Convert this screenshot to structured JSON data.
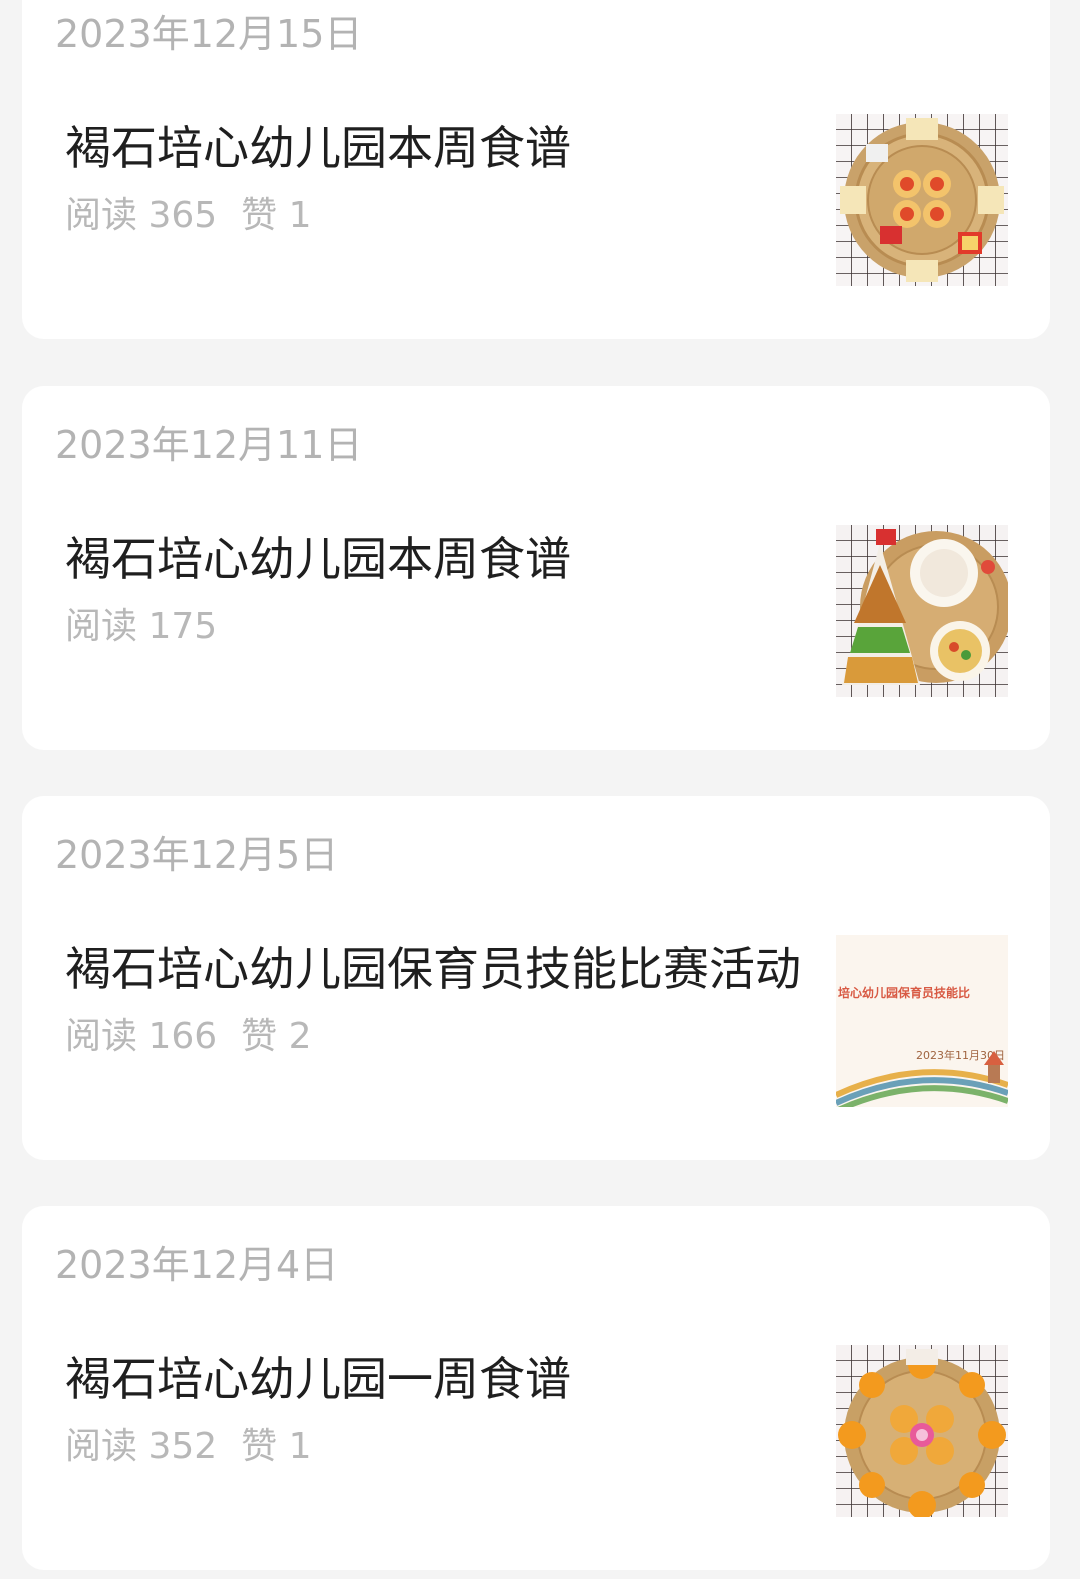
{
  "articles": [
    {
      "date": "2023年12月15日",
      "title": "褐石培心幼儿园本周食谱",
      "reads": "阅读 365",
      "likes": "赞 1",
      "thumb_icon": "food-plate-icon"
    },
    {
      "date": "2023年12月11日",
      "title": "褐石培心幼儿园本周食谱",
      "reads": "阅读 175",
      "likes": "",
      "thumb_icon": "meal-tray-icon"
    },
    {
      "date": "2023年12月5日",
      "title": "褐石培心幼儿园保育员技能比赛活动",
      "reads": "阅读 166",
      "likes": "赞 2",
      "thumb_icon": "event-banner-icon",
      "thumb_text_top": "培心幼儿园保育员技能比",
      "thumb_text_date": "2023年11月30日"
    },
    {
      "date": "2023年12月4日",
      "title": "褐石培心幼儿园一周食谱",
      "reads": "阅读 352",
      "likes": "赞 1",
      "thumb_icon": "orange-plate-icon"
    }
  ],
  "colors": {
    "background": "#f4f4f4",
    "card": "#ffffff",
    "title": "#1f1f1f",
    "meta": "#b3b3b3"
  }
}
